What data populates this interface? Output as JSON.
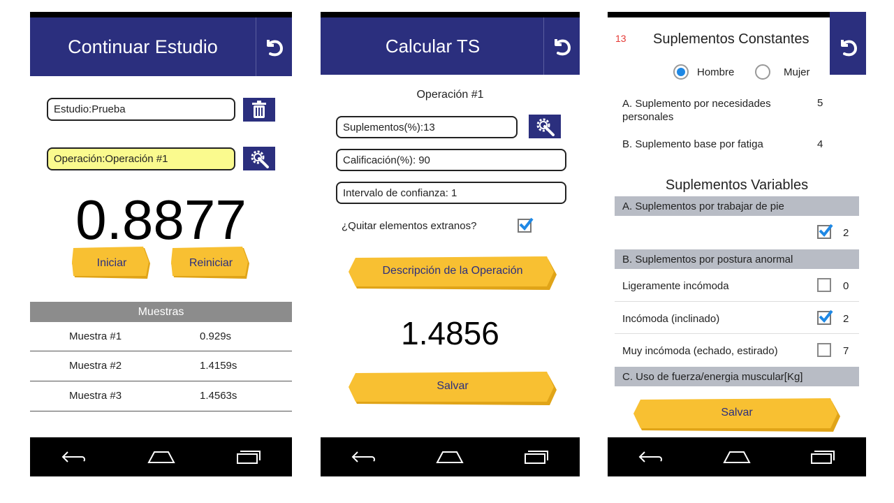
{
  "colors": {
    "header": "#2b2f7e",
    "button_yellow": "#f8c032",
    "highlight_field": "#fafa8e",
    "section_gray": "#b8bcc5",
    "accent_check": "#1e88e5",
    "counter_red": "#e53935"
  },
  "screen1": {
    "title": "Continuar Estudio",
    "back_icon": "undo-icon",
    "study_label": "Estudio:",
    "study_value": "Prueba",
    "delete_icon": "trash-icon",
    "operation_label": "Operación:",
    "operation_value": "Operación #1",
    "settings_icon": "gear-wrench-icon",
    "timer": "0.8877",
    "start_label": "Iniciar",
    "reset_label": "Reiniciar",
    "samples_header": "Muestras",
    "samples": [
      {
        "name": "Muestra #1",
        "value": "0.929s"
      },
      {
        "name": "Muestra #2",
        "value": "1.4159s"
      },
      {
        "name": "Muestra #3",
        "value": "1.4563s"
      }
    ]
  },
  "screen2": {
    "title": "Calcular TS",
    "back_icon": "undo-icon",
    "operation": "Operación #1",
    "supplements_label": "Suplementos(%):",
    "supplements_value": "13",
    "settings_icon": "gear-wrench-icon",
    "rating_label": "Calificación(%):",
    "rating_value": "90",
    "confidence_label": "Intervalo de confianza:",
    "confidence_value": "1",
    "remove_outliers_label": "¿Quitar elementos extranos?",
    "remove_outliers_checked": true,
    "description_button": "Descripción de la Operación",
    "result": "1.4856",
    "save_label": "Salvar"
  },
  "screen3": {
    "counter": "13",
    "title": "Suplementos Constantes",
    "back_icon": "undo-icon",
    "gender_options": [
      "Hombre",
      "Mujer"
    ],
    "gender_selected": "Hombre",
    "constants": [
      {
        "label": "A. Suplemento por necesidades personales",
        "value": "5"
      },
      {
        "label": "B. Suplemento base por fatiga",
        "value": "4"
      }
    ],
    "variables_title": "Suplementos Variables",
    "section_a": "A. Suplementos por trabajar de pie",
    "section_a_value": "2",
    "section_a_checked": true,
    "section_b": "B. Suplementos por postura anormal",
    "posture_items": [
      {
        "label": "Ligeramente incómoda",
        "checked": false,
        "value": "0"
      },
      {
        "label": "Incómoda (inclinado)",
        "checked": true,
        "value": "2"
      },
      {
        "label": "Muy incómoda (echado, estirado)",
        "checked": false,
        "value": "7"
      }
    ],
    "section_c": "C. Uso de fuerza/energia muscular[Kg]",
    "save_label": "Salvar"
  },
  "navbar": {
    "back_icon": "back-nav-icon",
    "home_icon": "home-nav-icon",
    "recents_icon": "recents-nav-icon"
  }
}
